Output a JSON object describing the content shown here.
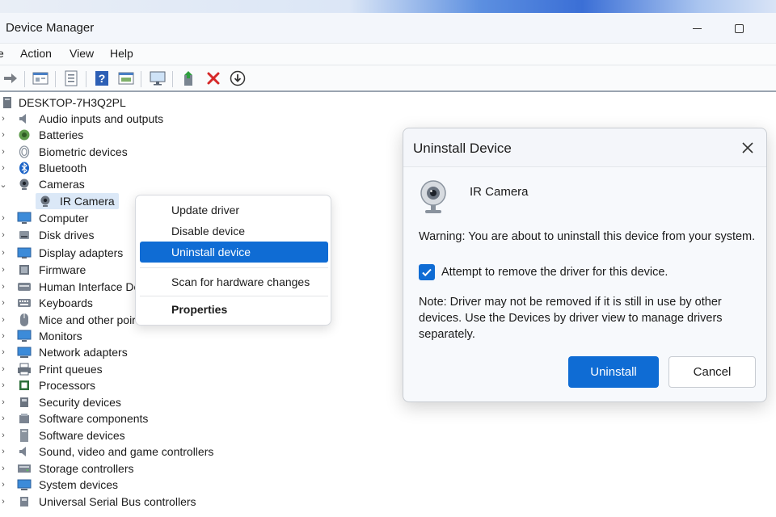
{
  "window": {
    "title": "Device Manager"
  },
  "menu": {
    "items": [
      {
        "label": "e"
      },
      {
        "label": "Action"
      },
      {
        "label": "View"
      },
      {
        "label": "Help"
      }
    ]
  },
  "toolbar": {
    "icons": [
      "forward-icon",
      "properties-sheet-icon",
      "device-list-icon",
      "help-icon",
      "view-icon",
      "monitor-icon",
      "add-driver-icon",
      "uninstall-x-icon",
      "download-icon"
    ]
  },
  "tree": {
    "root": "DESKTOP-7H3Q2PL",
    "categories": [
      {
        "label": "Audio inputs and outputs",
        "icon": "speaker-icon",
        "expanded": false
      },
      {
        "label": "Batteries",
        "icon": "battery-icon",
        "expanded": false
      },
      {
        "label": "Biometric devices",
        "icon": "fingerprint-icon",
        "expanded": false
      },
      {
        "label": "Bluetooth",
        "icon": "bluetooth-icon",
        "expanded": false
      },
      {
        "label": "Cameras",
        "icon": "webcam-icon",
        "expanded": true
      },
      {
        "label": "Computer",
        "icon": "monitor-icon",
        "expanded": false
      },
      {
        "label": "Disk drives",
        "icon": "disk-icon",
        "expanded": false
      },
      {
        "label": "Display adapters",
        "icon": "display-adapter-icon",
        "expanded": false
      },
      {
        "label": "Firmware",
        "icon": "firmware-icon",
        "expanded": false
      },
      {
        "label": "Human Interface De",
        "icon": "hid-icon",
        "expanded": false
      },
      {
        "label": "Keyboards",
        "icon": "keyboard-icon",
        "expanded": false
      },
      {
        "label": "Mice and other poir",
        "icon": "mouse-icon",
        "expanded": false
      },
      {
        "label": "Monitors",
        "icon": "monitor-icon",
        "expanded": false
      },
      {
        "label": "Network adapters",
        "icon": "network-icon",
        "expanded": false
      },
      {
        "label": "Print queues",
        "icon": "printer-icon",
        "expanded": false
      },
      {
        "label": "Processors",
        "icon": "chip-icon",
        "expanded": false
      },
      {
        "label": "Security devices",
        "icon": "security-icon",
        "expanded": false
      },
      {
        "label": "Software components",
        "icon": "component-icon",
        "expanded": false
      },
      {
        "label": "Software devices",
        "icon": "software-device-icon",
        "expanded": false
      },
      {
        "label": "Sound, video and game controllers",
        "icon": "speaker-icon",
        "expanded": false
      },
      {
        "label": "Storage controllers",
        "icon": "storage-icon",
        "expanded": false
      },
      {
        "label": "System devices",
        "icon": "system-icon",
        "expanded": false
      },
      {
        "label": "Universal Serial Bus controllers",
        "icon": "usb-icon",
        "expanded": false
      }
    ],
    "selected_child": "IR Camera"
  },
  "context_menu": {
    "items": [
      {
        "label": "Update driver"
      },
      {
        "label": "Disable device"
      },
      {
        "label": "Uninstall device",
        "highlighted": true
      },
      {
        "label": "Scan for hardware changes"
      },
      {
        "label": "Properties",
        "bold": true
      }
    ]
  },
  "dialog": {
    "title": "Uninstall Device",
    "device_name": "IR Camera",
    "warning": "Warning: You are about to uninstall this device from your system.",
    "checkbox_label": "Attempt to remove the driver for this device.",
    "checkbox_checked": true,
    "note": "Note: Driver may not be removed if it is still in use by other devices.  Use the Devices by driver view to manage drivers separately.",
    "primary_button": "Uninstall",
    "secondary_button": "Cancel"
  },
  "colors": {
    "accent": "#0f6cd4",
    "selection": "#dbe8f7"
  }
}
